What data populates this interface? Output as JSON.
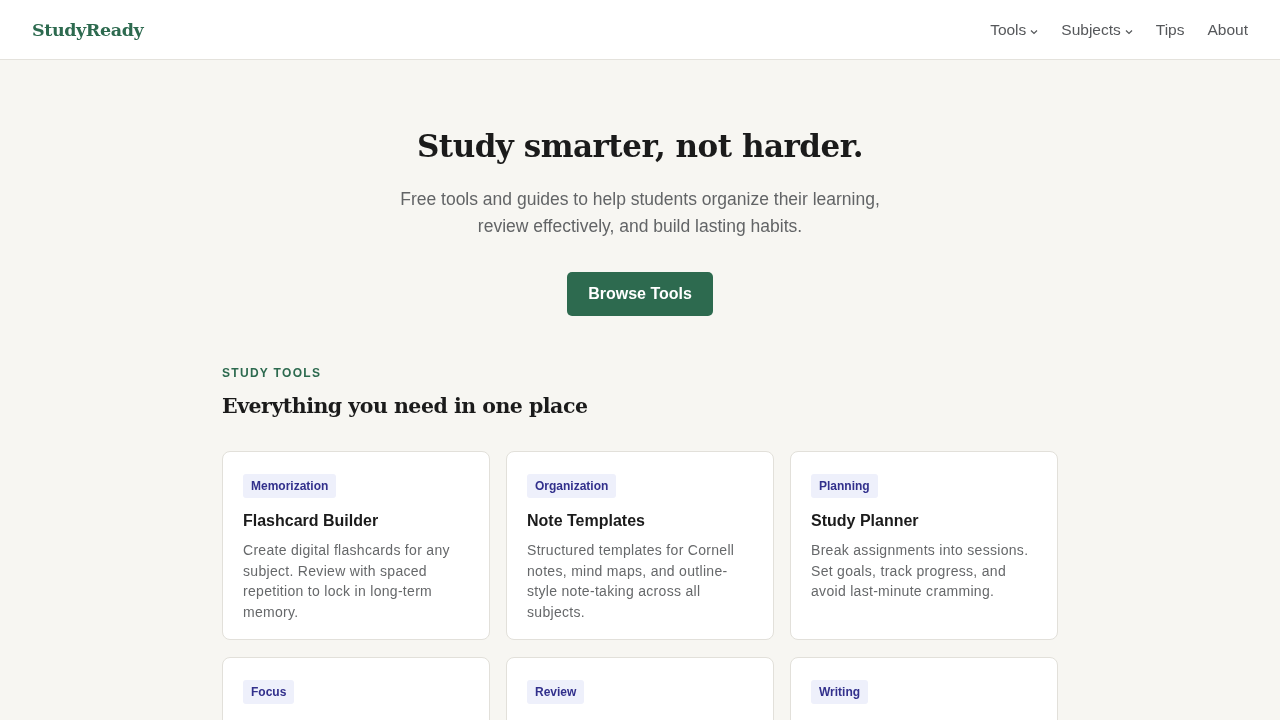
{
  "header": {
    "logo": "StudyReady",
    "nav": [
      {
        "label": "Tools",
        "kind": "dropdown"
      },
      {
        "label": "Subjects",
        "kind": "dropdown"
      },
      {
        "label": "Tips",
        "kind": "link"
      },
      {
        "label": "About",
        "kind": "link"
      }
    ]
  },
  "hero": {
    "title": "Study smarter, not harder.",
    "subtitle": "Free tools and guides to help students organize their learning, review effectively, and build lasting habits.",
    "button": "Browse Tools"
  },
  "tools_section": {
    "eyebrow": "STUDY TOOLS",
    "heading": "Everything you need in one place",
    "cards": [
      {
        "tag": "Memorization",
        "title": "Flashcard Builder",
        "description": "Create digital flashcards for any subject. Review with spaced repetition to lock in long-term memory."
      },
      {
        "tag": "Organization",
        "title": "Note Templates",
        "description": "Structured templates for Cornell notes, mind maps, and outline-style note-taking across all subjects."
      },
      {
        "tag": "Planning",
        "title": "Study Planner",
        "description": "Break assignments into sessions. Set goals, track progress, and avoid last-minute cramming."
      },
      {
        "tag": "Focus"
      },
      {
        "tag": "Review"
      },
      {
        "tag": "Writing"
      }
    ]
  }
}
